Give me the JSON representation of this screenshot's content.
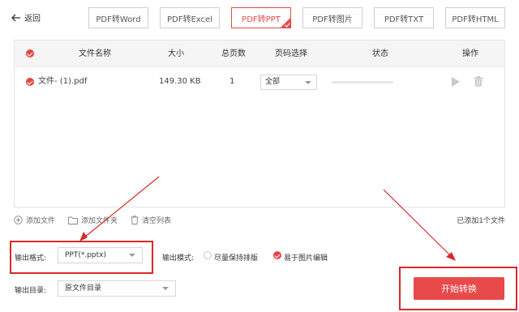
{
  "header": {
    "back_label": "返回",
    "tabs": [
      {
        "label": "PDF转Word"
      },
      {
        "label": "PDF转Excel"
      },
      {
        "label": "PDF转PPT"
      },
      {
        "label": "PDF转图片"
      },
      {
        "label": "PDF转TXT"
      },
      {
        "label": "PDF转HTML"
      }
    ],
    "active_tab": "PDF转PPT"
  },
  "table": {
    "columns": [
      "文件名称",
      "大小",
      "总页数",
      "页码选择",
      "状态",
      "操作"
    ],
    "rows": [
      {
        "name": "文件- (1).pdf",
        "size": "149.30 KB",
        "pages": "1",
        "page_select": "全部",
        "progress": 0
      }
    ]
  },
  "file_actions": {
    "add_file": "添加文件",
    "add_folder": "添加文件夹",
    "clear_list": "清空列表",
    "count_text": "已添加1个文件"
  },
  "output": {
    "format_label": "输出格式:",
    "format_value": "PPT(*.pptx)",
    "mode_label": "输出模式:",
    "mode_options": [
      {
        "label": "尽量保持排版",
        "checked": false
      },
      {
        "label": "易于图片编辑",
        "checked": true
      }
    ],
    "dir_label": "输出目录:",
    "dir_value": "原文件目录"
  },
  "start_button": "开始转换",
  "colors": {
    "accent": "#e84a4a",
    "annotation": "#d82a2a"
  }
}
